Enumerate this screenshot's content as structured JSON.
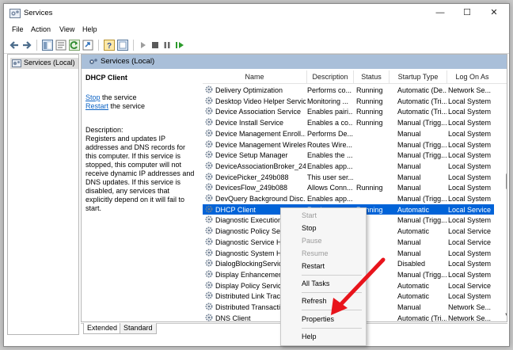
{
  "window": {
    "title": "Services",
    "min_glyph": "—",
    "max_glyph": "☐",
    "close_glyph": "✕"
  },
  "menu": [
    "File",
    "Action",
    "View",
    "Help"
  ],
  "tree": {
    "root_label": "Services (Local)"
  },
  "pane": {
    "header": "Services (Local)"
  },
  "details": {
    "service_name": "DHCP Client",
    "stop_link": "Stop",
    "stop_suffix": " the service",
    "restart_link": "Restart",
    "restart_suffix": " the service",
    "description_label": "Description:",
    "description_text": "Registers and updates IP addresses and DNS records for this computer. If this service is stopped, this computer will not receive dynamic IP addresses and DNS updates. If this service is disabled, any services that explicitly depend on it will fail to start."
  },
  "table": {
    "columns": [
      "Name",
      "Description",
      "Status",
      "Startup Type",
      "Log On As"
    ],
    "rows": [
      [
        "Delivery Optimization",
        "Performs co...",
        "Running",
        "Automatic (De...",
        "Network Se..."
      ],
      [
        "Desktop Video Helper Service",
        "Monitoring ...",
        "Running",
        "Automatic (Tri...",
        "Local System"
      ],
      [
        "Device Association Service",
        "Enables pairi...",
        "Running",
        "Automatic (Tri...",
        "Local System"
      ],
      [
        "Device Install Service",
        "Enables a co...",
        "Running",
        "Manual (Trigg...",
        "Local System"
      ],
      [
        "Device Management Enroll...",
        "Performs De...",
        "",
        "Manual",
        "Local System"
      ],
      [
        "Device Management Wireles...",
        "Routes Wire...",
        "",
        "Manual (Trigg...",
        "Local System"
      ],
      [
        "Device Setup Manager",
        "Enables the ...",
        "",
        "Manual (Trigg...",
        "Local System"
      ],
      [
        "DeviceAssociationBroker_24...",
        "Enables app...",
        "",
        "Manual",
        "Local System"
      ],
      [
        "DevicePicker_249b088",
        "This user ser...",
        "",
        "Manual",
        "Local System"
      ],
      [
        "DevicesFlow_249b088",
        "Allows Conn...",
        "Running",
        "Manual",
        "Local System"
      ],
      [
        "DevQuery Background Disc...",
        "Enables app...",
        "",
        "Manual (Trigg...",
        "Local System"
      ],
      [
        "DHCP Client",
        "Registers an...",
        "Running",
        "Automatic",
        "Local Service"
      ],
      [
        "Diagnostic Execution S",
        "",
        "",
        "Manual (Trigg...",
        "Local System"
      ],
      [
        "Diagnostic Policy Servic",
        "",
        "",
        "Automatic",
        "Local Service"
      ],
      [
        "Diagnostic Service Hos",
        "",
        "",
        "Manual",
        "Local Service"
      ],
      [
        "Diagnostic System Hos",
        "",
        "",
        "Manual",
        "Local System"
      ],
      [
        "DialogBlockingService",
        "",
        "",
        "Disabled",
        "Local System"
      ],
      [
        "Display Enhancement S",
        "",
        "",
        "Manual (Trigg...",
        "Local System"
      ],
      [
        "Display Policy Service",
        "",
        "",
        "Automatic",
        "Local Service"
      ],
      [
        "Distributed Link Trackin",
        "",
        "",
        "Automatic",
        "Local System"
      ],
      [
        "Distributed Transaction",
        "",
        "",
        "Manual",
        "Network Se..."
      ],
      [
        "DNS Client",
        "",
        "",
        "Automatic (Tri...",
        "Network Se..."
      ]
    ],
    "selected_row_index": 11
  },
  "tabs": {
    "extended": "Extended",
    "standard": "Standard"
  },
  "context_menu": {
    "items": [
      "Start",
      "Stop",
      "Pause",
      "Resume",
      "Restart",
      "All Tasks",
      "Refresh",
      "Properties",
      "Help"
    ],
    "submenu_arrow": "›"
  },
  "colors": {
    "selection": "#0063d8",
    "pane_header": "#a9bfd9",
    "link": "#0b62c4",
    "arrow": "#e8141c"
  },
  "icons": [
    "services-app-icon",
    "back-icon",
    "forward-icon",
    "console-tree-icon",
    "properties-icon",
    "refresh-icon",
    "export-icon",
    "help-icon",
    "view-icon",
    "start-service-icon",
    "stop-service-icon",
    "pause-service-icon",
    "restart-service-icon",
    "gear-icon"
  ]
}
